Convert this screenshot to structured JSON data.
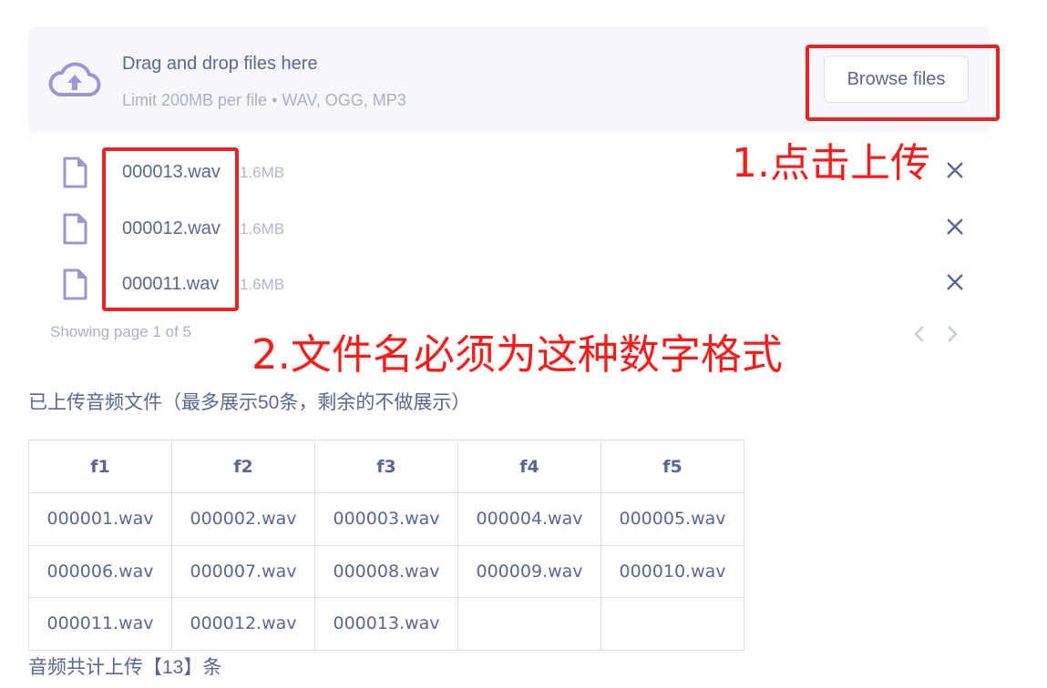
{
  "uploader": {
    "title": "Drag and drop files here",
    "subtitle": "Limit 200MB per file • WAV, OGG, MP3",
    "browse_label": "Browse files",
    "icon": "cloud-upload-icon",
    "accent_color": "#9c98cf"
  },
  "uploaded_files": [
    {
      "name": "000013.wav",
      "size": "1.6MB"
    },
    {
      "name": "000012.wav",
      "size": "1.6MB"
    },
    {
      "name": "000011.wav",
      "size": "1.6MB"
    }
  ],
  "pagination": {
    "text": "Showing page 1 of 5",
    "current_page": 1,
    "total_pages": 5
  },
  "annotations": {
    "step1": "1.点击上传",
    "step2": "2.文件名必须为这种数字格式",
    "color": "#ff1a1a"
  },
  "section_title": "已上传音频文件（最多展示50条，剩余的不做展示）",
  "table": {
    "headers": [
      "f1",
      "f2",
      "f3",
      "f4",
      "f5"
    ],
    "rows": [
      [
        "000001.wav",
        "000002.wav",
        "000003.wav",
        "000004.wav",
        "000005.wav"
      ],
      [
        "000006.wav",
        "000007.wav",
        "000008.wav",
        "000009.wav",
        "000010.wav"
      ],
      [
        "000011.wav",
        "000012.wav",
        "000013.wav",
        "",
        ""
      ]
    ]
  },
  "summary": "音频共计上传【13】条"
}
